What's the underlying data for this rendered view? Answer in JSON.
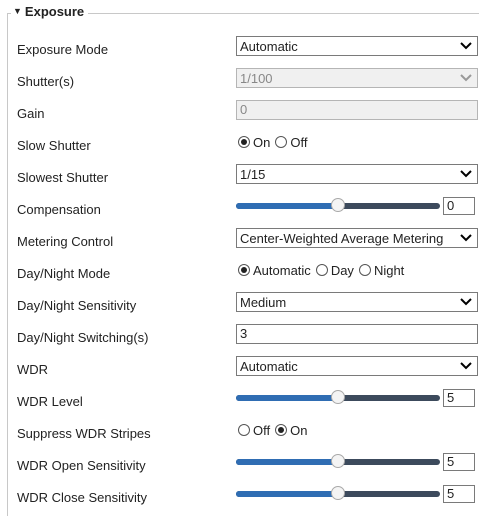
{
  "section": {
    "title": "Exposure"
  },
  "rows": {
    "exposure_mode": {
      "label": "Exposure Mode",
      "value": "Automatic"
    },
    "shutter": {
      "label": "Shutter(s)",
      "value": "1/100"
    },
    "gain": {
      "label": "Gain",
      "value": "0"
    },
    "slow_shutter": {
      "label": "Slow Shutter",
      "opt1": "On",
      "opt2": "Off",
      "selected": "On"
    },
    "slowest_shutter": {
      "label": "Slowest Shutter",
      "value": "1/15"
    },
    "compensation": {
      "label": "Compensation",
      "value": "0",
      "level": 0.5
    },
    "metering_control": {
      "label": "Metering Control",
      "value": "Center-Weighted Average Metering"
    },
    "day_night_mode": {
      "label": "Day/Night Mode",
      "opt1": "Automatic",
      "opt2": "Day",
      "opt3": "Night",
      "selected": "Automatic"
    },
    "day_night_sensitivity": {
      "label": "Day/Night Sensitivity",
      "value": "Medium"
    },
    "day_night_switching": {
      "label": "Day/Night Switching(s)",
      "value": "3"
    },
    "wdr": {
      "label": "WDR",
      "value": "Automatic"
    },
    "wdr_level": {
      "label": "WDR Level",
      "value": "5",
      "level": 0.5
    },
    "suppress_wdr_stripes": {
      "label": "Suppress WDR Stripes",
      "opt1": "Off",
      "opt2": "On",
      "selected": "On"
    },
    "wdr_open_sensitivity": {
      "label": "WDR Open Sensitivity",
      "value": "5",
      "level": 0.5
    },
    "wdr_close_sensitivity": {
      "label": "WDR Close Sensitivity",
      "value": "5",
      "level": 0.5
    }
  }
}
